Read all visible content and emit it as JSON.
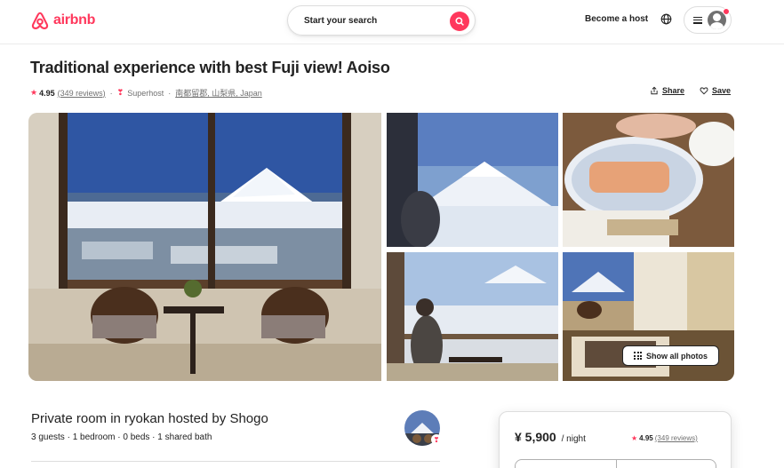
{
  "header": {
    "brand": "airbnb",
    "search_placeholder": "Start your search",
    "become_host": "Become a host"
  },
  "listing": {
    "title": "Traditional experience with best Fuji view! Aoiso",
    "rating": "4.95",
    "reviews": "(349 reviews)",
    "superhost": "Superhost",
    "location": "南都留郡, 山梨県, Japan",
    "share": "Share",
    "save": "Save",
    "show_all_photos": "Show all photos"
  },
  "room": {
    "title": "Private room in ryokan hosted by Shogo",
    "details": "3 guests · 1 bedroom · 0 beds · 1 shared bath"
  },
  "booking": {
    "price": "¥ 5,900",
    "per": "/ night",
    "rating": "4.95",
    "reviews": "(349 reviews)"
  },
  "colors": {
    "brand": "#ff385c",
    "text": "#222222",
    "muted": "#717171"
  }
}
